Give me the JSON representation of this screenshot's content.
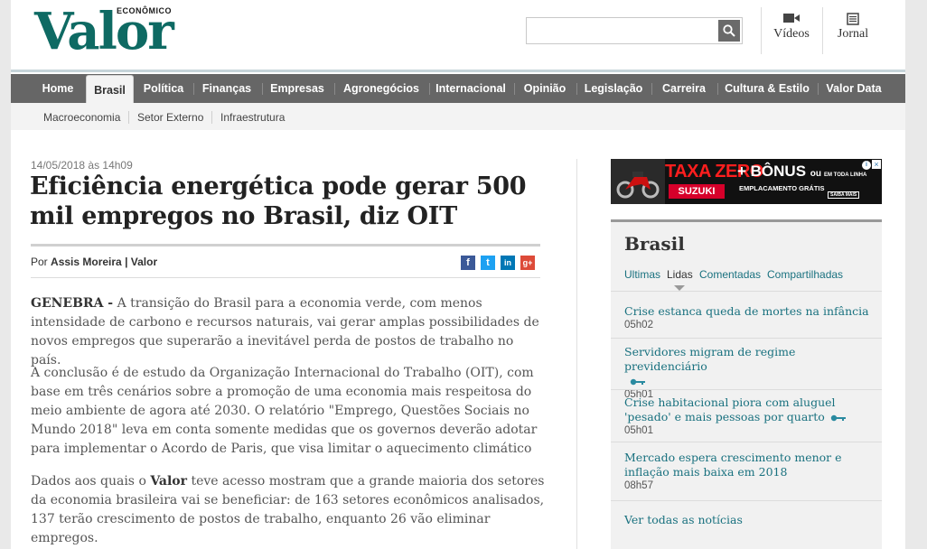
{
  "header": {
    "logo": "Valor",
    "logo_tag": "ECONÔMICO",
    "search_placeholder": "",
    "videos_label": "Vídeos",
    "jornal_label": "Jornal"
  },
  "nav": {
    "items": [
      "Home",
      "Brasil",
      "Política",
      "Finanças",
      "Empresas",
      "Agronegócios",
      "Internacional",
      "Opinião",
      "Legislação",
      "Carreira",
      "Cultura & Estilo",
      "Valor Data"
    ],
    "active": "Brasil"
  },
  "subnav": {
    "items": [
      "Macroeconomia",
      "Setor Externo",
      "Infraestrutura"
    ]
  },
  "article": {
    "date": "14/05/2018 às 14h09",
    "title": "Eficiência energética pode gerar 500 mil empregos no Brasil, diz OIT",
    "byline_prefix": "Por",
    "byline_author": "Assis Moreira | Valor",
    "share": [
      "f",
      "t",
      "in",
      "g+"
    ],
    "lead_place": "GENEBRA  -",
    "p1": "A transição do Brasil para a economia verde, com menos intensidade de carbono e recursos naturais, vai gerar amplas possibilidades de novos empregos que superarão a inevitável perda de postos de trabalho no país.",
    "p2": "A conclusão é de estudo da Organização Internacional do Trabalho (OIT), com base em três cenários sobre a promoção de uma economia mais respeitosa do meio ambiente de agora até 2030. O relatório \"Emprego, Questões Sociais no Mundo 2018\" leva em conta somente medidas que os governos deverão adotar para implementar o Acordo de Paris, que visa limitar o aquecimento climático",
    "p3_pre": "Dados aos quais o",
    "p3_strong": "Valor",
    "p3_post": "teve acesso mostram que a grande maioria dos setores da economia brasileira vai se beneficiar: de 163 setores econômicos analisados, 137 terão crescimento de postos de trabalho, enquanto 26 vão eliminar empregos."
  },
  "ad": {
    "taxa": "TAXA ZERO",
    "brand": "SUZUKI",
    "bonus": "+ BÔNUS",
    "ou": "ou",
    "emplacamento": "EMPLACAMENTO GRÁTIS",
    "linha": "EM TODA LINHA",
    "saiba": "SAIBA MAIS",
    "info": "i",
    "close": "×"
  },
  "sidebar": {
    "title": "Brasil",
    "tabs": [
      "Ultimas",
      "Lidas",
      "Comentadas",
      "Compartilhadas"
    ],
    "active_tab": "Lidas",
    "items": [
      {
        "title": "Crise estanca queda de mortes na infância",
        "time": "05h02",
        "locked": false
      },
      {
        "title": "Servidores migram de regime previdenciário",
        "time": "05h01",
        "locked": true
      },
      {
        "title": "Crise habitacional piora com aluguel 'pesado' e mais pessoas por quarto",
        "time": "05h01",
        "locked": true
      },
      {
        "title": "Mercado espera crescimento menor e inflação mais baixa em 2018",
        "time": "08h57",
        "locked": false
      }
    ],
    "see_all": "Ver todas as notícias"
  },
  "colors": {
    "brand": "#0e6a63",
    "nav_bg": "#666666",
    "link": "#19717f"
  }
}
